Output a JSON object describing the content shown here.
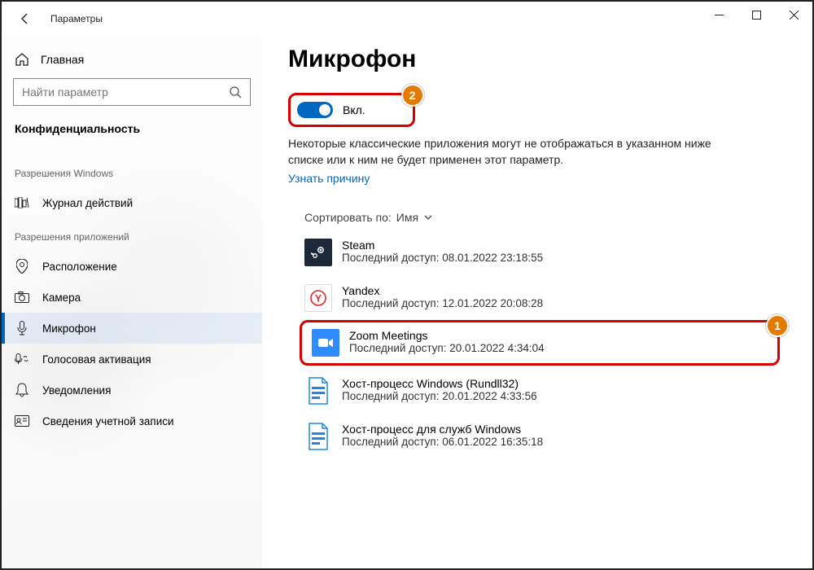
{
  "window": {
    "title": "Параметры",
    "minimize": "—",
    "maximize": "▢",
    "close": "✕"
  },
  "sidebar": {
    "home": "Главная",
    "searchPlaceholder": "Найти параметр",
    "category": "Конфиденциальность",
    "group1": "Разрешения Windows",
    "group2": "Разрешения приложений",
    "items1": [
      {
        "label": "Журнал действий"
      }
    ],
    "items2": [
      {
        "label": "Расположение"
      },
      {
        "label": "Камера"
      },
      {
        "label": "Микрофон"
      },
      {
        "label": "Голосовая активация"
      },
      {
        "label": "Уведомления"
      },
      {
        "label": "Сведения учетной записи"
      }
    ]
  },
  "main": {
    "heading": "Микрофон",
    "toggleLabel": "Вкл.",
    "desc1": "Некоторые классические приложения могут не отображаться в указанном ниже списке или к ним не будет применен этот параметр.",
    "learnMore": "Узнать причину",
    "sortLabel": "Сортировать по:",
    "sortValue": "Имя",
    "accessPrefix": "Последний доступ: ",
    "apps": [
      {
        "name": "Steam",
        "access": "08.01.2022 23:18:55",
        "bg": "#1b2838",
        "glyph": "◯"
      },
      {
        "name": "Yandex",
        "access": "12.01.2022 20:08:28",
        "bg": "#ffffff",
        "glyph": "Y"
      },
      {
        "name": "Zoom Meetings",
        "access": "20.01.2022 4:34:04",
        "bg": "#2d8cff",
        "glyph": "▣"
      },
      {
        "name": "Хост-процесс Windows (Rundll32)",
        "access": "20.01.2022 4:33:56",
        "bg": "#1e88e5",
        "glyph": "▤"
      },
      {
        "name": "Хост-процесс для служб Windows",
        "access": "06.01.2022 16:35:18",
        "bg": "#1e88e5",
        "glyph": "▤"
      }
    ],
    "badge1": "1",
    "badge2": "2"
  }
}
